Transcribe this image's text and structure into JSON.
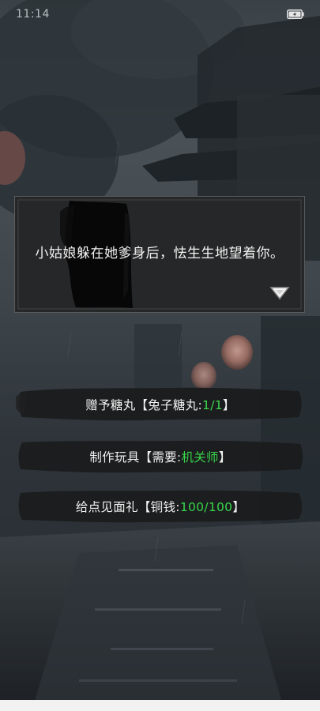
{
  "status_bar": {
    "time": "11:14",
    "battery_icon": "battery-charging-icon"
  },
  "dialog": {
    "text": "小姑娘躲在她爹身后，怯生生地望着你。",
    "next_icon": "triangle-down-icon"
  },
  "choices": [
    {
      "prefix": "赠予糖丸【兔子糖丸:",
      "highlight": "1/1",
      "suffix": "】"
    },
    {
      "prefix": "制作玩具【需要:",
      "highlight": "机关师",
      "suffix": "】"
    },
    {
      "prefix": "给点见面礼【铜钱:",
      "highlight": "100/100",
      "suffix": "】"
    }
  ],
  "colors": {
    "highlight": "#38d64a",
    "dialog_text": "#f2f2f2",
    "panel": "#2b2c2d"
  }
}
